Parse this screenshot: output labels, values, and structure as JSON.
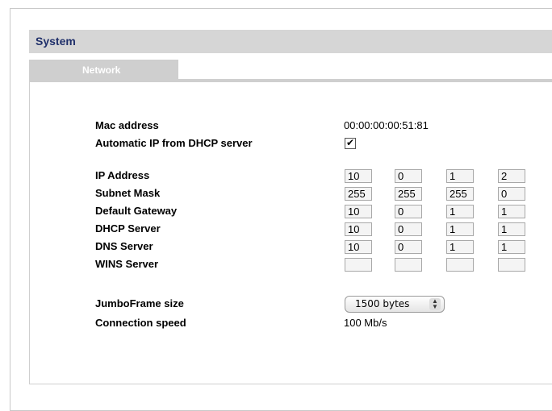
{
  "system": {
    "title": "System"
  },
  "tabs": [
    {
      "label": "Network",
      "active": true
    }
  ],
  "network": {
    "mac_label": "Mac address",
    "mac_value": "00:00:00:00:51:81",
    "dhcp_label": "Automatic IP from DHCP server",
    "dhcp_checked": true,
    "dhcp_mark": "✔",
    "ip_rows": [
      {
        "label": "IP Address",
        "values": [
          "10",
          "0",
          "1",
          "2"
        ]
      },
      {
        "label": "Subnet Mask",
        "values": [
          "255",
          "255",
          "255",
          "0"
        ]
      },
      {
        "label": "Default Gateway",
        "values": [
          "10",
          "0",
          "1",
          "1"
        ]
      },
      {
        "label": "DHCP Server",
        "values": [
          "10",
          "0",
          "1",
          "1"
        ]
      },
      {
        "label": "DNS Server",
        "values": [
          "10",
          "0",
          "1",
          "1"
        ]
      },
      {
        "label": "WINS Server",
        "values": [
          "",
          "",
          "",
          ""
        ]
      }
    ],
    "jumbo_label": "JumboFrame size",
    "jumbo_value": "1500 bytes",
    "speed_label": "Connection speed",
    "speed_value": "100 Mb/s"
  },
  "icons": {
    "select_arrows": "up-down-arrows-icon",
    "checkbox": "checkmark-icon"
  }
}
